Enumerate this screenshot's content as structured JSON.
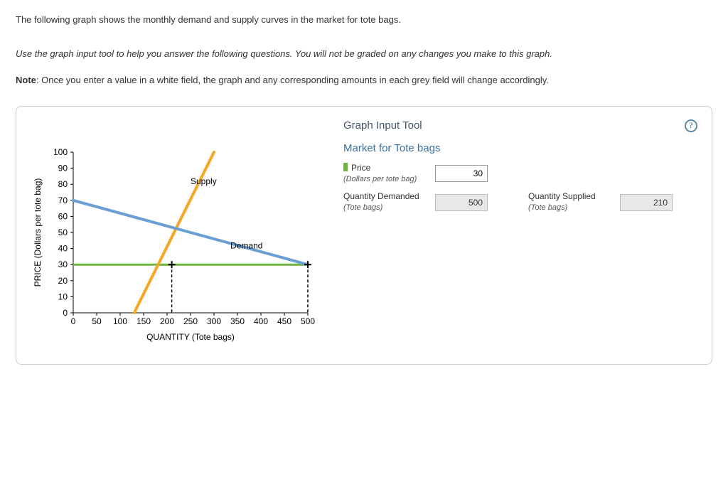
{
  "intro": "The following graph shows the monthly demand and supply curves in the market for tote bags.",
  "instructions": "Use the graph input tool to help you answer the following questions. You will not be graded on any changes you make to this graph.",
  "note_label": "Note",
  "note_body": ": Once you enter a value in a white field, the graph and any corresponding amounts in each grey field will change accordingly.",
  "chart_data": {
    "type": "line",
    "xlabel": "QUANTITY (Tote bags)",
    "ylabel": "PRICE (Dollars per tote bag)",
    "xlim": [
      0,
      500
    ],
    "ylim": [
      0,
      100
    ],
    "x_ticks": [
      0,
      50,
      100,
      150,
      200,
      250,
      300,
      350,
      400,
      450,
      500
    ],
    "y_ticks": [
      0,
      10,
      20,
      30,
      40,
      50,
      60,
      70,
      80,
      90,
      100
    ],
    "series": [
      {
        "name": "Supply",
        "color": "#f5a623",
        "points": [
          [
            130,
            0
          ],
          [
            300,
            100
          ]
        ]
      },
      {
        "name": "Demand",
        "color": "#6a9fd4",
        "points": [
          [
            0,
            70
          ],
          [
            500,
            30
          ]
        ]
      }
    ],
    "price_line": {
      "y": 30,
      "color": "#6db33f"
    },
    "drop_lines": [
      {
        "x": 500,
        "y": 30,
        "color": "#000"
      },
      {
        "x": 210,
        "y": 30,
        "color": "#000"
      }
    ],
    "labels": [
      {
        "text": "Supply",
        "x": 250,
        "y": 80
      },
      {
        "text": "Demand",
        "x": 335,
        "y": 40
      }
    ]
  },
  "tool": {
    "title": "Graph Input Tool",
    "market": "Market for Tote bags",
    "price_label": "Price",
    "price_sub": "(Dollars per tote bag)",
    "price_value": "30",
    "qd_label": "Quantity Demanded",
    "qd_sub": "(Tote bags)",
    "qd_value": "500",
    "qs_label": "Quantity Supplied",
    "qs_sub": "(Tote bags)",
    "qs_value": "210",
    "help": "?"
  }
}
